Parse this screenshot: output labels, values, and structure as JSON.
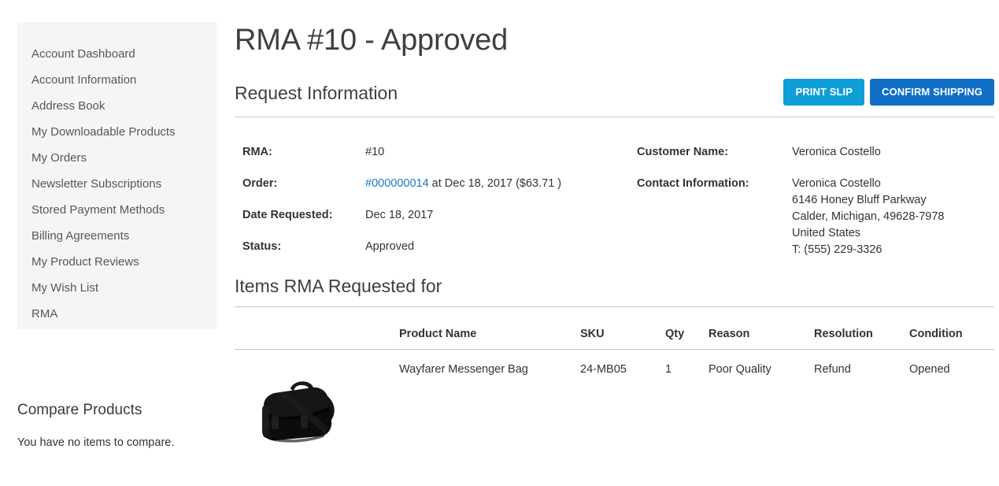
{
  "sidebar": {
    "items": [
      {
        "label": "Account Dashboard"
      },
      {
        "label": "Account Information"
      },
      {
        "label": "Address Book"
      },
      {
        "label": "My Downloadable Products"
      },
      {
        "label": "My Orders"
      },
      {
        "label": "Newsletter Subscriptions"
      },
      {
        "label": "Stored Payment Methods"
      },
      {
        "label": "Billing Agreements"
      },
      {
        "label": "My Product Reviews"
      },
      {
        "label": "My Wish List"
      },
      {
        "label": "RMA"
      }
    ],
    "compare": {
      "title": "Compare Products",
      "empty_text": "You have no items to compare."
    }
  },
  "main": {
    "page_title": "RMA #10 - Approved",
    "request_information": {
      "section_title": "Request Information",
      "buttons": {
        "print_slip": "PRINT SLIP",
        "confirm_shipping": "CONFIRM SHIPPING"
      },
      "left": {
        "rma_label": "RMA:",
        "rma_value": "#10",
        "order_label": "Order:",
        "order_link": "#000000014",
        "order_suffix": " at Dec 18, 2017 ($63.71 )",
        "date_requested_label": "Date Requested:",
        "date_requested_value": "Dec 18, 2017",
        "status_label": "Status:",
        "status_value": "Approved"
      },
      "right": {
        "customer_name_label": "Customer Name:",
        "customer_name_value": "Veronica Costello",
        "contact_information_label": "Contact Information:",
        "contact_lines": [
          "Veronica Costello",
          "6146 Honey Bluff Parkway",
          "Calder, Michigan, 49628-7978",
          "United States",
          "T: (555) 229-3326"
        ]
      }
    },
    "items": {
      "section_title": "Items RMA Requested for",
      "columns": {
        "thumb": "",
        "product_name": "Product Name",
        "sku": "SKU",
        "qty": "Qty",
        "reason": "Reason",
        "resolution": "Resolution",
        "condition": "Condition"
      },
      "rows": [
        {
          "product_name": "Wayfarer Messenger Bag",
          "sku": "24-MB05",
          "qty": "1",
          "reason": "Poor Quality",
          "resolution": "Refund",
          "condition": "Opened"
        }
      ]
    }
  },
  "colors": {
    "print_slip_button": "#0f9fd8",
    "confirm_shipping_button": "#0e6fc4",
    "link": "#1979c3",
    "sidebar_background": "#f5f5f5",
    "divider": "#c6c6c6",
    "text": "#333333"
  }
}
